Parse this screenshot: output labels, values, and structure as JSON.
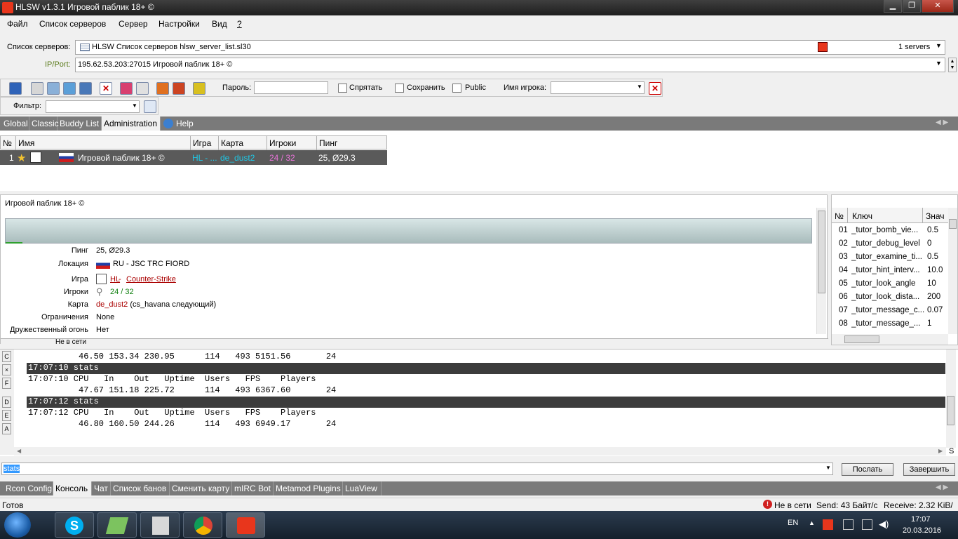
{
  "window": {
    "title": "HLSW v1.3.1   Игровой паблик 18+ ©"
  },
  "menu": [
    "Файл",
    "Список серверов",
    "Сервер",
    "Настройки",
    "Вид",
    "?"
  ],
  "server_list": {
    "label": "Список серверов:",
    "value": "HLSW Список серверов  hlsw_server_list.sl30",
    "count": "1 servers"
  },
  "ipport": {
    "label": "IP/Port:",
    "value": "195.62.53.203:27015 Игровой паблик 18+ ©"
  },
  "toolbar": {
    "password_label": "Пароль:",
    "hide_label": "Спрятать",
    "save_label": "Сохранить",
    "public_label": "Public",
    "player_name_label": "Имя игрока:",
    "filter_label": "Фильтр:"
  },
  "tabs": [
    "Global",
    "Classic",
    "Buddy List",
    "Administration",
    "Help"
  ],
  "table": {
    "headers": [
      "№",
      "Имя",
      "Игра",
      "Карта",
      "Игроки",
      "Пинг"
    ],
    "row": {
      "num": "1",
      "name": "Игровой паблик 18+ ©",
      "game": "HL - ...",
      "map": "de_dust2",
      "players": "24 / 32",
      "ping": "25, Ø29.3"
    }
  },
  "info": {
    "server_name": "Игровой паблик 18+ ©",
    "ping_label": "Пинг",
    "ping": "25, Ø29.3",
    "location_label": "Локация",
    "location": "RU - JSC TRC FIORD",
    "game_label": "Игра",
    "game_hl": "HL",
    "game_sep": " - ",
    "game_name": "Counter-Strike",
    "players_label": "Игроки",
    "players": "24 / 32",
    "map_label": "Карта",
    "map": "de_dust2",
    "map_next": " (cs_havana следующий)",
    "restrictions_label": "Ограничения",
    "restrictions": "None",
    "ff_label": "Дружественный огонь",
    "ff": "Нет",
    "status_cut": "Не в сети"
  },
  "cvars": {
    "headers": [
      "№",
      "Ключ",
      "Знач"
    ],
    "rows": [
      {
        "n": "01",
        "k": "_tutor_bomb_vie...",
        "v": "0.5"
      },
      {
        "n": "02",
        "k": "_tutor_debug_level",
        "v": "0"
      },
      {
        "n": "03",
        "k": "_tutor_examine_ti...",
        "v": "0.5"
      },
      {
        "n": "04",
        "k": "_tutor_hint_interv...",
        "v": "10.0"
      },
      {
        "n": "05",
        "k": "_tutor_look_angle",
        "v": "10"
      },
      {
        "n": "06",
        "k": "_tutor_look_dista...",
        "v": "200"
      },
      {
        "n": "07",
        "k": "_tutor_message_c...",
        "v": "0.07"
      },
      {
        "n": "08",
        "k": "_tutor_message_...",
        "v": "1"
      }
    ]
  },
  "console": {
    "lines": [
      {
        "text": "46.50 153.34 230.95      114   493 5151.56       24",
        "indent": true,
        "hl": false
      },
      {
        "text": "17:07:10 stats",
        "indent": false,
        "hl": true
      },
      {
        "text": "17:07:10 CPU   In    Out   Uptime  Users   FPS    Players",
        "indent": false,
        "hl": false
      },
      {
        "text": "47.67 151.18 225.72      114   493 6367.60       24",
        "indent": true,
        "hl": false
      },
      {
        "text": "17:07:12 stats",
        "indent": false,
        "hl": true
      },
      {
        "text": "17:07:12 CPU   In    Out   Uptime  Users   FPS    Players",
        "indent": false,
        "hl": false
      },
      {
        "text": "46.80 160.50 244.26      114   493 6949.17       24",
        "indent": true,
        "hl": false
      }
    ],
    "side_buttons": [
      "C",
      "×",
      "F",
      "D",
      "E",
      "A"
    ],
    "input": "stats",
    "send_label": "Послать",
    "finish_label": "Завершить",
    "s_label": "S"
  },
  "bottom_tabs": [
    "Rcon Config",
    "Консоль",
    "Чат",
    "Список банов",
    "Сменить карту",
    "mIRC Bot",
    "Metamod Plugins",
    "LuaView"
  ],
  "status": {
    "ready": "Готов",
    "offline": "Не в сети",
    "send": "Send:  43 Байт/с",
    "receive": "Receive:  2.32 KiB/"
  },
  "taskbar": {
    "lang": "EN",
    "time": "17:07",
    "date": "20.03.2016"
  },
  "colors": {
    "tab_bar": "#7a7a7a",
    "selected_row": "#5a5a5a",
    "game_cyan": "#1ec8e6",
    "players_pink": "#e873d8",
    "link_red": "#aa0000",
    "players_green": "#108010"
  }
}
